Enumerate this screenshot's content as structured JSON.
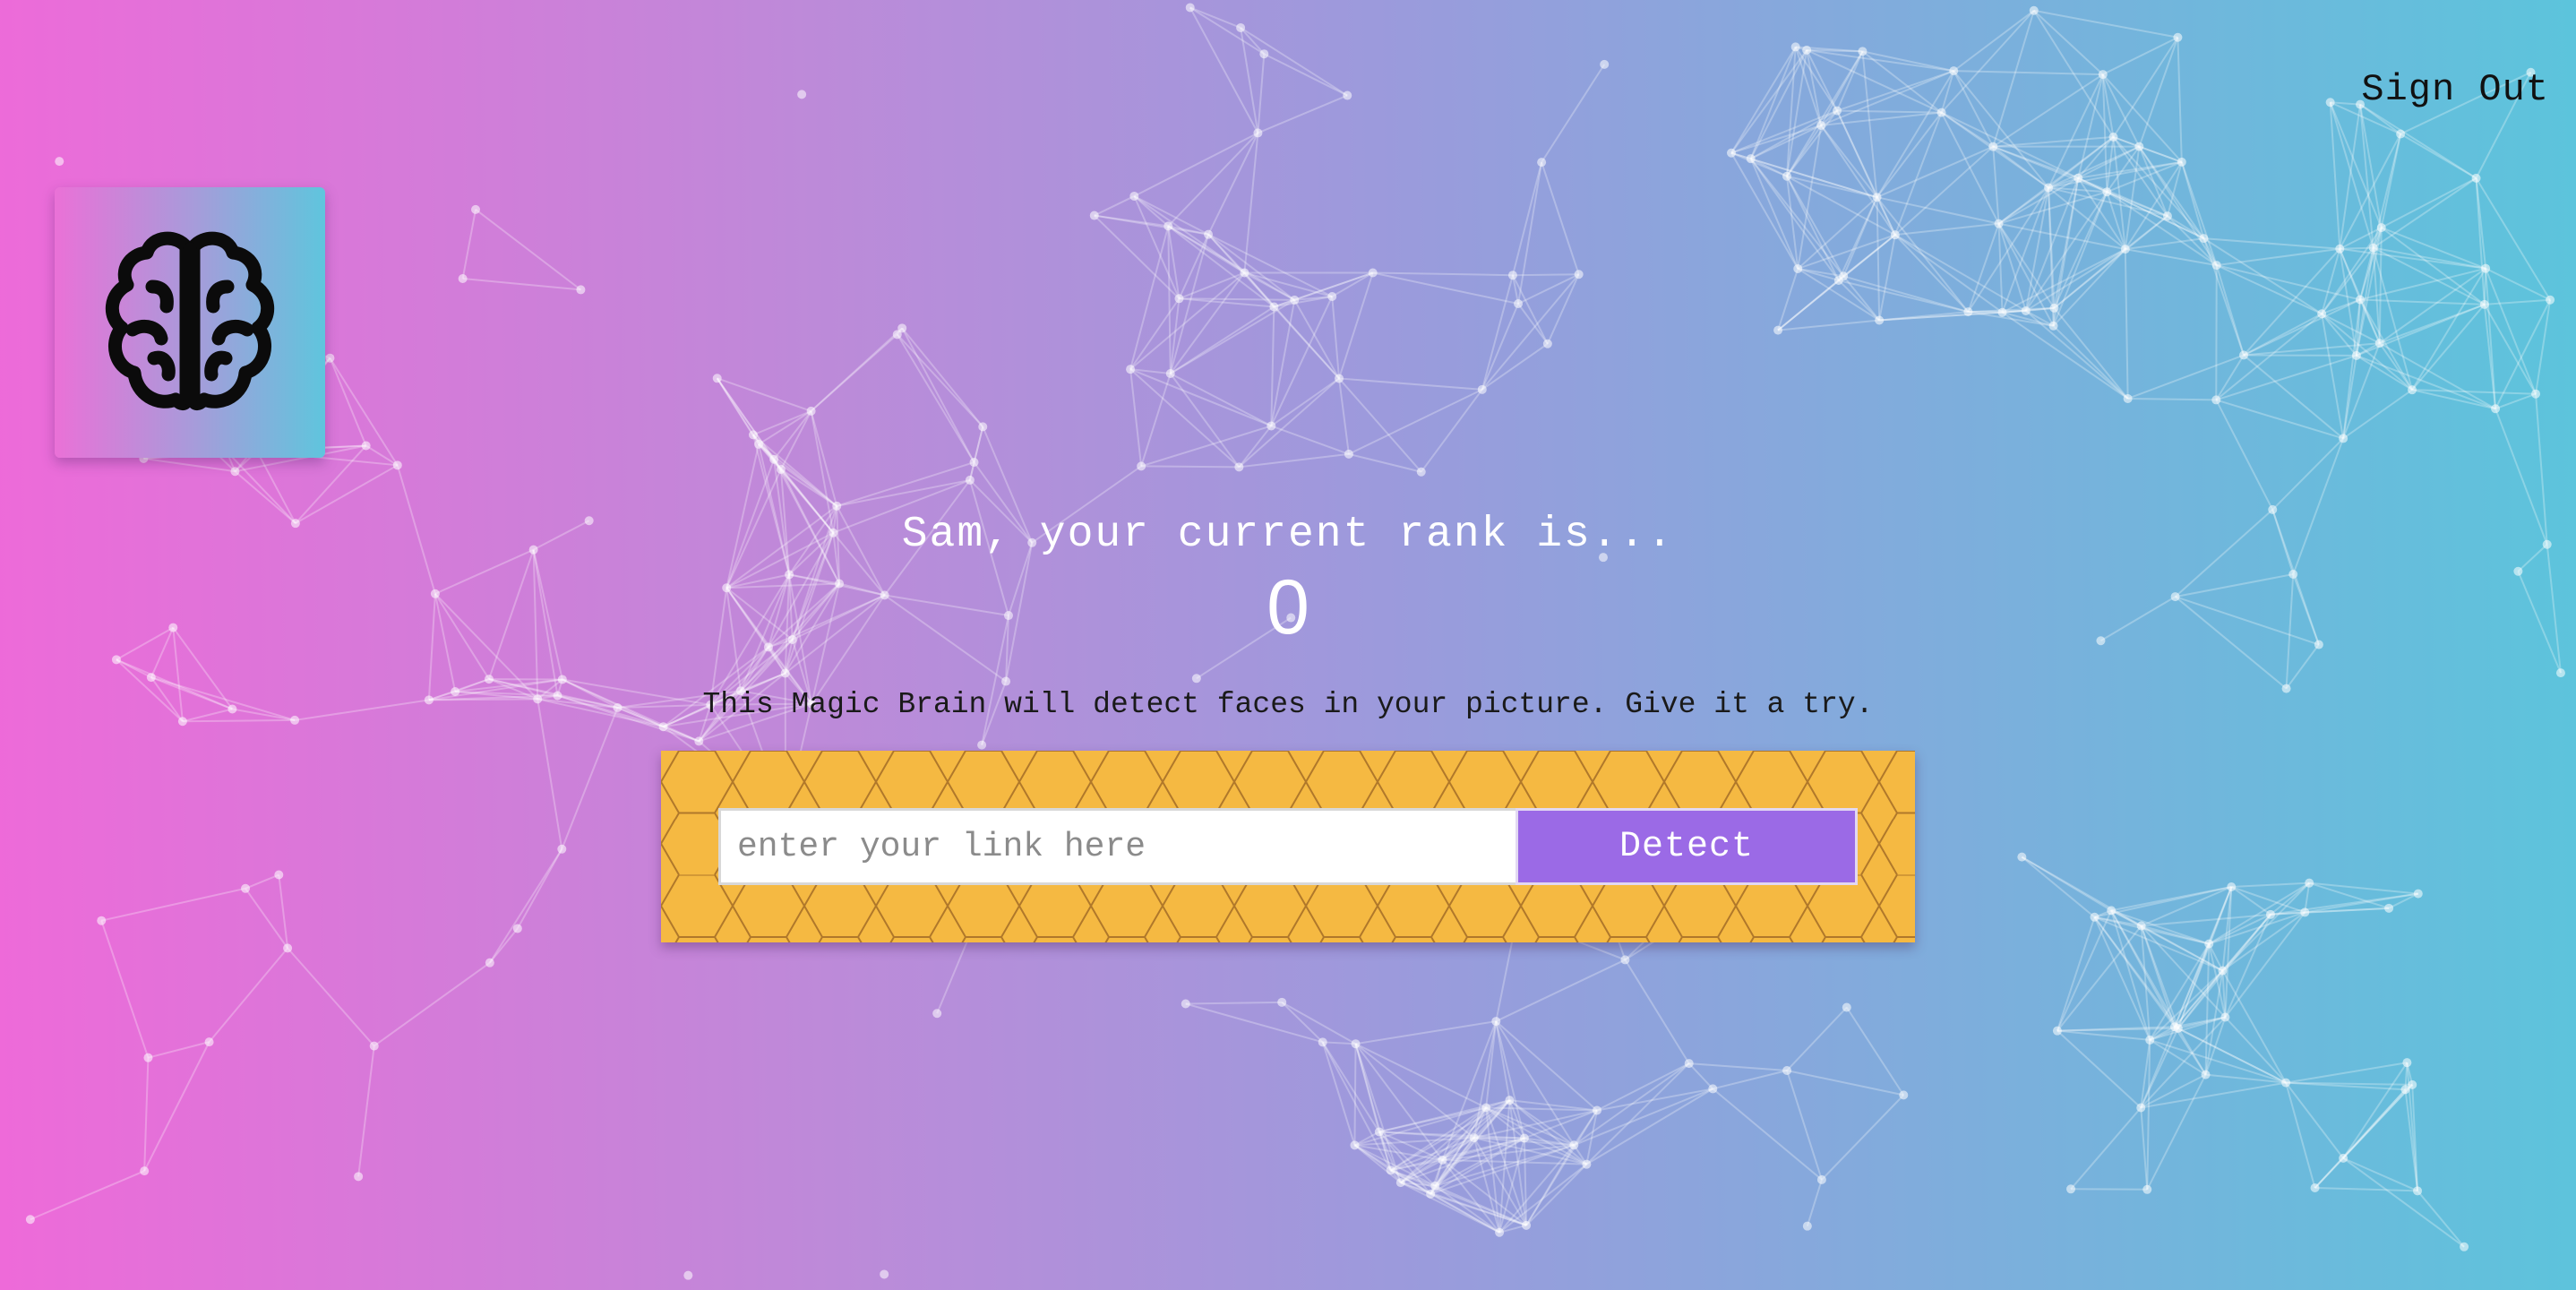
{
  "nav": {
    "sign_out_label": "Sign Out"
  },
  "logo": {
    "icon": "brain-icon"
  },
  "rank": {
    "message": "Sam, your current rank is...",
    "value": "0"
  },
  "intro": {
    "text": "This Magic Brain will detect faces in your picture. Give it a try."
  },
  "image_form": {
    "input_placeholder": "enter your link here",
    "input_value": "",
    "detect_label": "Detect"
  },
  "colors": {
    "gradient_left": "#ee6ad9",
    "gradient_right": "#5cc4dc",
    "panel": "#f5b942",
    "button": "#9b6ae6"
  }
}
